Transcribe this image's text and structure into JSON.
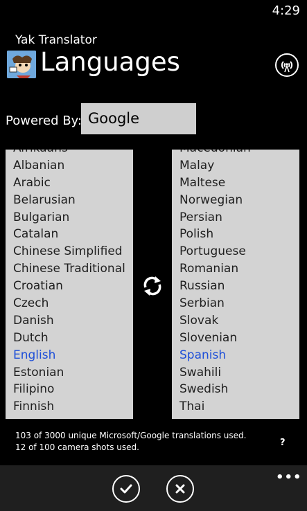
{
  "status": {
    "time": "4:29"
  },
  "app": {
    "name": "Yak Translator",
    "title": "Languages"
  },
  "powered_by": {
    "label": "Powered By:",
    "engine": "Google"
  },
  "source_list": {
    "items": [
      "Afrikaans",
      "Albanian",
      "Arabic",
      "Belarusian",
      "Bulgarian",
      "Catalan",
      "Chinese Simplified",
      "Chinese Traditional",
      "Croatian",
      "Czech",
      "Danish",
      "Dutch",
      "English",
      "Estonian",
      "Filipino",
      "Finnish"
    ],
    "selected": "English"
  },
  "target_list": {
    "items": [
      "Macedonian",
      "Malay",
      "Maltese",
      "Norwegian",
      "Persian",
      "Polish",
      "Portuguese",
      "Romanian",
      "Russian",
      "Serbian",
      "Slovak",
      "Slovenian",
      "Spanish",
      "Swahili",
      "Swedish",
      "Thai"
    ],
    "selected": "Spanish"
  },
  "usage": {
    "translations": "103 of 3000 unique Microsoft/Google translations used.",
    "camera": "12 of 100 camera shots used."
  },
  "help_label": "?",
  "more_label": "•••",
  "icons": {
    "broadcast": "broadcast-icon",
    "swap": "swap-icon",
    "confirm": "check-icon",
    "cancel": "close-icon"
  },
  "colors": {
    "selected": "#1e4fd8",
    "list_bg": "#d3d3d3",
    "appbar_bg": "#1f1f1f"
  }
}
